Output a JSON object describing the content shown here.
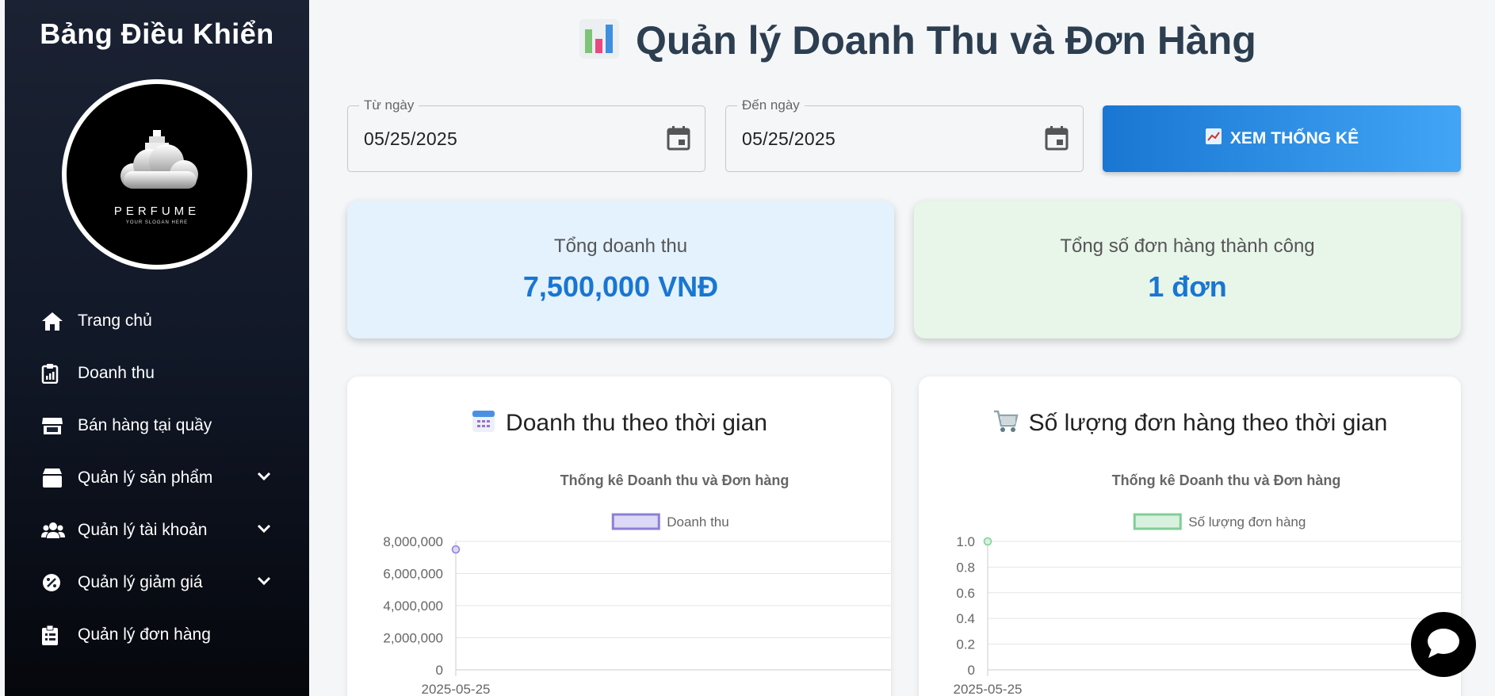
{
  "sidebar": {
    "title": "Bảng Điều Khiển",
    "logo": {
      "brand": "PERFUME",
      "slogan": "YOUR SLOGAN HERE"
    },
    "items": [
      {
        "label": "Trang chủ",
        "icon": "home-icon",
        "expandable": false
      },
      {
        "label": "Doanh thu",
        "icon": "clipboard-chart-icon",
        "expandable": false
      },
      {
        "label": "Bán hàng tại quầy",
        "icon": "store-icon",
        "expandable": false
      },
      {
        "label": "Quản lý sản phẩm",
        "icon": "box-icon",
        "expandable": true
      },
      {
        "label": "Quản lý tài khoản",
        "icon": "users-icon",
        "expandable": true
      },
      {
        "label": "Quản lý giảm giá",
        "icon": "percent-badge-icon",
        "expandable": true
      },
      {
        "label": "Quản lý đơn hàng",
        "icon": "clipboard-list-icon",
        "expandable": false
      }
    ]
  },
  "header": {
    "title": "Quản lý Doanh Thu và Đơn Hàng",
    "icon": "bar-chart-emoji-icon"
  },
  "filters": {
    "from": {
      "label": "Từ ngày",
      "value": "05/25/2025"
    },
    "to": {
      "label": "Đến ngày",
      "value": "05/25/2025"
    },
    "button_label": "XEM THỐNG KÊ"
  },
  "kpis": {
    "revenue": {
      "label": "Tổng doanh thu",
      "value": "7,500,000 VNĐ",
      "bg": "#e3f2fd"
    },
    "orders": {
      "label": "Tổng số đơn hàng thành công",
      "value": "1 đơn",
      "bg": "#e8f5e9"
    }
  },
  "colors": {
    "accent": "#1976d2",
    "revenue_series": "#8b7fd9",
    "orders_series": "#7fcf96"
  },
  "cards": [
    {
      "title": "Doanh thu theo thời gian",
      "icon": "calendar-emoji-icon"
    },
    {
      "title": "Số lượng đơn hàng theo thời gian",
      "icon": "cart-emoji-icon"
    }
  ],
  "chart_data": [
    {
      "type": "line",
      "title": "Thống kê Doanh thu và Đơn hàng",
      "x": [
        "2025-05-25"
      ],
      "series": [
        {
          "name": "Doanh thu",
          "values": [
            7500000
          ]
        }
      ],
      "ylim": [
        0,
        8000000
      ],
      "yticks": [
        "0",
        "2,000,000",
        "4,000,000",
        "6,000,000",
        "8,000,000"
      ],
      "grid": true,
      "legend": "top"
    },
    {
      "type": "line",
      "title": "Thống kê Doanh thu và Đơn hàng",
      "x": [
        "2025-05-25"
      ],
      "series": [
        {
          "name": "Số lượng đơn hàng",
          "values": [
            1
          ]
        }
      ],
      "ylim": [
        0,
        1
      ],
      "yticks": [
        "0",
        "0.2",
        "0.4",
        "0.6",
        "0.8",
        "1.0"
      ],
      "grid": true,
      "legend": "top"
    }
  ]
}
